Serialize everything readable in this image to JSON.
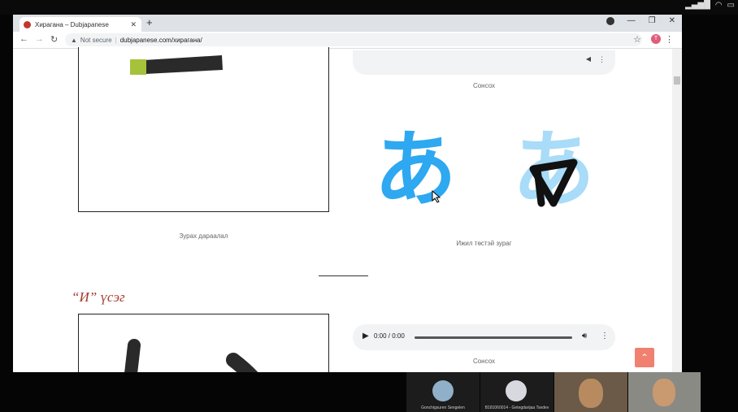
{
  "browser": {
    "tab_title": "Хирагана – Dubjapanese",
    "new_tab": "+",
    "not_secure": "Not secure",
    "url": "dubjapanese.com/хирагана/",
    "avatar_letter": "T"
  },
  "page": {
    "caption_stroke_order": "Зурах дараалал",
    "caption_sound_1": "Сонсох",
    "caption_similar": "Ижил төстэй зураг",
    "section_title": "“И” үсэг",
    "audio_time": "0:00 / 0:00",
    "caption_sound_2": "Сонсох",
    "hiragana_a": "あ"
  },
  "zoom": {
    "participant_1": "Gonchigsuren Sengelen",
    "participant_2": "B181060014 - Getegdarijaa Tsedev"
  },
  "colors": {
    "hiragana_blue": "#2ea8f0",
    "hiragana_light_blue": "#a8dcf8",
    "section_title": "#a33a2c",
    "scroll_top": "#f08070"
  }
}
